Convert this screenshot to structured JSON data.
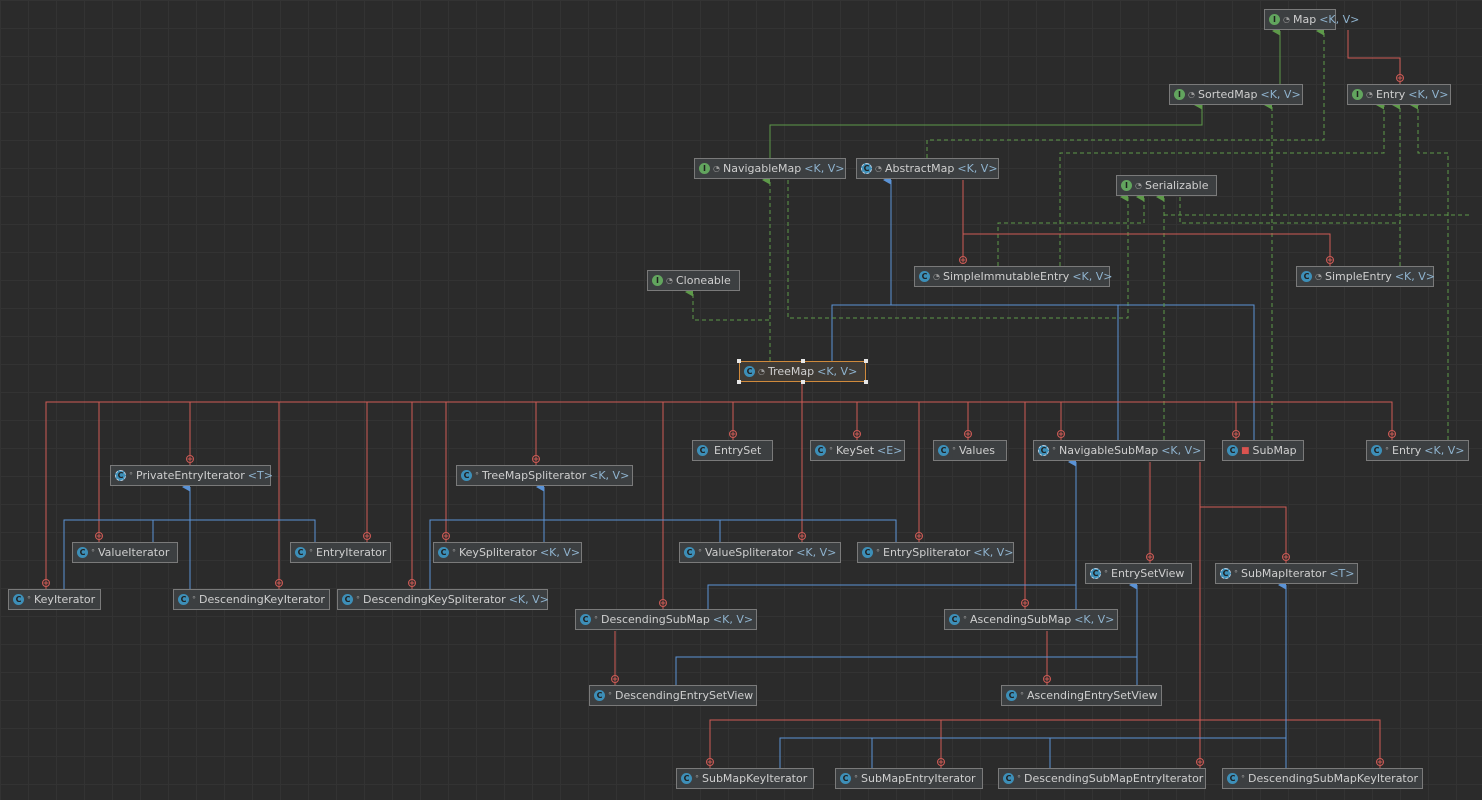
{
  "diagram": {
    "nodes": [
      {
        "id": "map",
        "name": "Map",
        "params": "<K, V>",
        "kind": "interface",
        "mod": "lock-open"
      },
      {
        "id": "sortedmap",
        "name": "SortedMap",
        "params": "<K, V>",
        "kind": "interface",
        "mod": "lock-open"
      },
      {
        "id": "entry_top",
        "name": "Entry",
        "params": "<K, V>",
        "kind": "interface",
        "mod": "lock-open"
      },
      {
        "id": "navigablemap",
        "name": "NavigableMap",
        "params": "<K, V>",
        "kind": "interface",
        "mod": "lock-open"
      },
      {
        "id": "abstractmap",
        "name": "AbstractMap",
        "params": "<K, V>",
        "kind": "abstract",
        "mod": "lock-open"
      },
      {
        "id": "serializable",
        "name": "Serializable",
        "params": "",
        "kind": "interface",
        "mod": "lock-open"
      },
      {
        "id": "simpleimmutableentry",
        "name": "SimpleImmutableEntry",
        "params": "<K, V>",
        "kind": "class",
        "mod": "lock-open"
      },
      {
        "id": "simpleentry",
        "name": "SimpleEntry",
        "params": "<K, V>",
        "kind": "class",
        "mod": "lock-open"
      },
      {
        "id": "cloneable",
        "name": "Cloneable",
        "params": "",
        "kind": "interface",
        "mod": "lock-open"
      },
      {
        "id": "treemap",
        "name": "TreeMap",
        "params": "<K, V>",
        "kind": "class",
        "mod": "lock-open"
      },
      {
        "id": "entryset",
        "name": "EntrySet",
        "params": "",
        "kind": "class",
        "mod": ""
      },
      {
        "id": "keyset",
        "name": "KeySet",
        "params": "<E>",
        "kind": "class",
        "mod": "dot"
      },
      {
        "id": "values",
        "name": "Values",
        "params": "",
        "kind": "class",
        "mod": "dot"
      },
      {
        "id": "navigablesubmap",
        "name": "NavigableSubMap",
        "params": "<K, V>",
        "kind": "abstract",
        "mod": "dot"
      },
      {
        "id": "submap",
        "name": "SubMap",
        "params": "",
        "kind": "class",
        "mod": "lock"
      },
      {
        "id": "entry_inner",
        "name": "Entry",
        "params": "<K, V>",
        "kind": "class",
        "mod": "dot"
      },
      {
        "id": "privateentryiterator",
        "name": "PrivateEntryIterator",
        "params": "<T>",
        "kind": "abstract",
        "mod": "dot"
      },
      {
        "id": "treemapspliterator",
        "name": "TreeMapSpliterator",
        "params": "<K, V>",
        "kind": "class",
        "mod": "dot"
      },
      {
        "id": "valueiterator",
        "name": "ValueIterator",
        "params": "",
        "kind": "class",
        "mod": "dot"
      },
      {
        "id": "entryiterator",
        "name": "EntryIterator",
        "params": "",
        "kind": "class",
        "mod": "dot"
      },
      {
        "id": "keyspliterator",
        "name": "KeySpliterator",
        "params": "<K, V>",
        "kind": "class",
        "mod": "dot"
      },
      {
        "id": "valuespliterator",
        "name": "ValueSpliterator",
        "params": "<K, V>",
        "kind": "class",
        "mod": "dot"
      },
      {
        "id": "entryspliterator",
        "name": "EntrySpliterator",
        "params": "<K, V>",
        "kind": "class",
        "mod": "dot"
      },
      {
        "id": "keyiterator",
        "name": "KeyIterator",
        "params": "",
        "kind": "class",
        "mod": "dot"
      },
      {
        "id": "descendingkeyiterator",
        "name": "DescendingKeyIterator",
        "params": "",
        "kind": "class",
        "mod": "dot"
      },
      {
        "id": "descendingkeyspliterator",
        "name": "DescendingKeySpliterator",
        "params": "<K, V>",
        "kind": "class",
        "mod": "dot"
      },
      {
        "id": "entrysetview",
        "name": "EntrySetView",
        "params": "",
        "kind": "abstract",
        "mod": "dot"
      },
      {
        "id": "submapiterator",
        "name": "SubMapIterator",
        "params": "<T>",
        "kind": "abstract",
        "mod": "dot"
      },
      {
        "id": "descendingsubmap",
        "name": "DescendingSubMap",
        "params": "<K, V>",
        "kind": "class",
        "mod": "dot"
      },
      {
        "id": "ascendingsubmap",
        "name": "AscendingSubMap",
        "params": "<K, V>",
        "kind": "class",
        "mod": "dot"
      },
      {
        "id": "descendingentrysetview",
        "name": "DescendingEntrySetView",
        "params": "",
        "kind": "class",
        "mod": "dot"
      },
      {
        "id": "ascendingentrysetview",
        "name": "AscendingEntrySetView",
        "params": "",
        "kind": "class",
        "mod": "dot"
      },
      {
        "id": "submapkeyiterator",
        "name": "SubMapKeyIterator",
        "params": "",
        "kind": "class",
        "mod": "dot"
      },
      {
        "id": "submapentryiterator",
        "name": "SubMapEntryIterator",
        "params": "",
        "kind": "class",
        "mod": "dot"
      },
      {
        "id": "descendingsubmapentryiterator",
        "name": "DescendingSubMapEntryIterator",
        "params": "",
        "kind": "class",
        "mod": "dot"
      },
      {
        "id": "descendingsubmapkeyiterator",
        "name": "DescendingSubMapKeyIterator",
        "params": "",
        "kind": "class",
        "mod": "dot"
      }
    ],
    "selected": "treemap",
    "colors": {
      "implements": "#5e9a4a",
      "extends": "#5b93d6",
      "inner": "#cf5b56",
      "grid": "#333333",
      "background": "#2b2b2b",
      "node_border": "#7a7a7a",
      "selected_border": "#d08a3c"
    },
    "edges": [
      {
        "from": "sortedmap",
        "to": "map",
        "type": "implements"
      },
      {
        "from": "entry_top",
        "to": "map",
        "type": "inner"
      },
      {
        "from": "navigablemap",
        "to": "sortedmap",
        "type": "implements"
      },
      {
        "from": "abstractmap",
        "to": "map",
        "type": "implements-dashed"
      },
      {
        "from": "treemap",
        "to": "navigablemap",
        "type": "implements-dashed"
      },
      {
        "from": "treemap",
        "to": "abstractmap",
        "type": "extends"
      },
      {
        "from": "treemap",
        "to": "cloneable",
        "type": "implements-dashed"
      },
      {
        "from": "treemap",
        "to": "serializable",
        "type": "implements-dashed"
      },
      {
        "from": "simpleimmutableentry",
        "to": "abstractmap",
        "type": "inner"
      },
      {
        "from": "simpleentry",
        "to": "abstractmap",
        "type": "inner"
      },
      {
        "from": "simpleimmutableentry",
        "to": "serializable",
        "type": "implements-dashed"
      },
      {
        "from": "simpleentry",
        "to": "serializable",
        "type": "implements-dashed"
      },
      {
        "from": "simpleimmutableentry",
        "to": "entry_top",
        "type": "implements-dashed"
      },
      {
        "from": "simpleentry",
        "to": "entry_top",
        "type": "implements-dashed"
      },
      {
        "from": "entry_inner",
        "to": "entry_top",
        "type": "implements-dashed"
      },
      {
        "from": "navigablesubmap",
        "to": "abstractmap",
        "type": "extends"
      },
      {
        "from": "navigablesubmap",
        "to": "navigablemap",
        "type": "implements-dashed"
      },
      {
        "from": "submap",
        "to": "abstractmap",
        "type": "extends"
      },
      {
        "from": "submap",
        "to": "sortedmap",
        "type": "implements-dashed"
      },
      {
        "from": "valueiterator",
        "to": "privateentryiterator",
        "type": "extends"
      },
      {
        "from": "entryiterator",
        "to": "privateentryiterator",
        "type": "extends"
      },
      {
        "from": "keyiterator",
        "to": "privateentryiterator",
        "type": "extends"
      },
      {
        "from": "descendingkeyiterator",
        "to": "privateentryiterator",
        "type": "extends"
      },
      {
        "from": "keyspliterator",
        "to": "treemapspliterator",
        "type": "extends"
      },
      {
        "from": "valuespliterator",
        "to": "treemapspliterator",
        "type": "extends"
      },
      {
        "from": "entryspliterator",
        "to": "treemapspliterator",
        "type": "extends"
      },
      {
        "from": "descendingkeyspliterator",
        "to": "treemapspliterator",
        "type": "extends"
      },
      {
        "from": "ascendingsubmap",
        "to": "navigablesubmap",
        "type": "extends"
      },
      {
        "from": "descendingsubmap",
        "to": "navigablesubmap",
        "type": "extends"
      },
      {
        "from": "descendingentrysetview",
        "to": "entrysetview",
        "type": "extends"
      },
      {
        "from": "ascendingentrysetview",
        "to": "entrysetview",
        "type": "extends"
      },
      {
        "from": "submapkeyiterator",
        "to": "submapiterator",
        "type": "extends"
      },
      {
        "from": "submapentryiterator",
        "to": "submapiterator",
        "type": "extends"
      },
      {
        "from": "descendingsubmapentryiterator",
        "to": "submapiterator",
        "type": "extends"
      },
      {
        "from": "descendingsubmapkeyiterator",
        "to": "submapiterator",
        "type": "extends"
      },
      {
        "from": "entrysetview",
        "to": "navigablesubmap",
        "type": "inner"
      },
      {
        "from": "submapiterator",
        "to": "navigablesubmap",
        "type": "inner"
      },
      {
        "from": "descendingentrysetview",
        "to": "descendingsubmap",
        "type": "inner"
      },
      {
        "from": "ascendingentrysetview",
        "to": "ascendingsubmap",
        "type": "inner"
      },
      {
        "from": "submapkeyiterator",
        "to": "navigablesubmap",
        "type": "inner"
      },
      {
        "from": "submapentryiterator",
        "to": "navigablesubmap",
        "type": "inner"
      },
      {
        "from": "descendingsubmapentryiterator",
        "to": "navigablesubmap",
        "type": "inner"
      },
      {
        "from": "descendingsubmapkeyiterator",
        "to": "navigablesubmap",
        "type": "inner"
      }
    ]
  }
}
